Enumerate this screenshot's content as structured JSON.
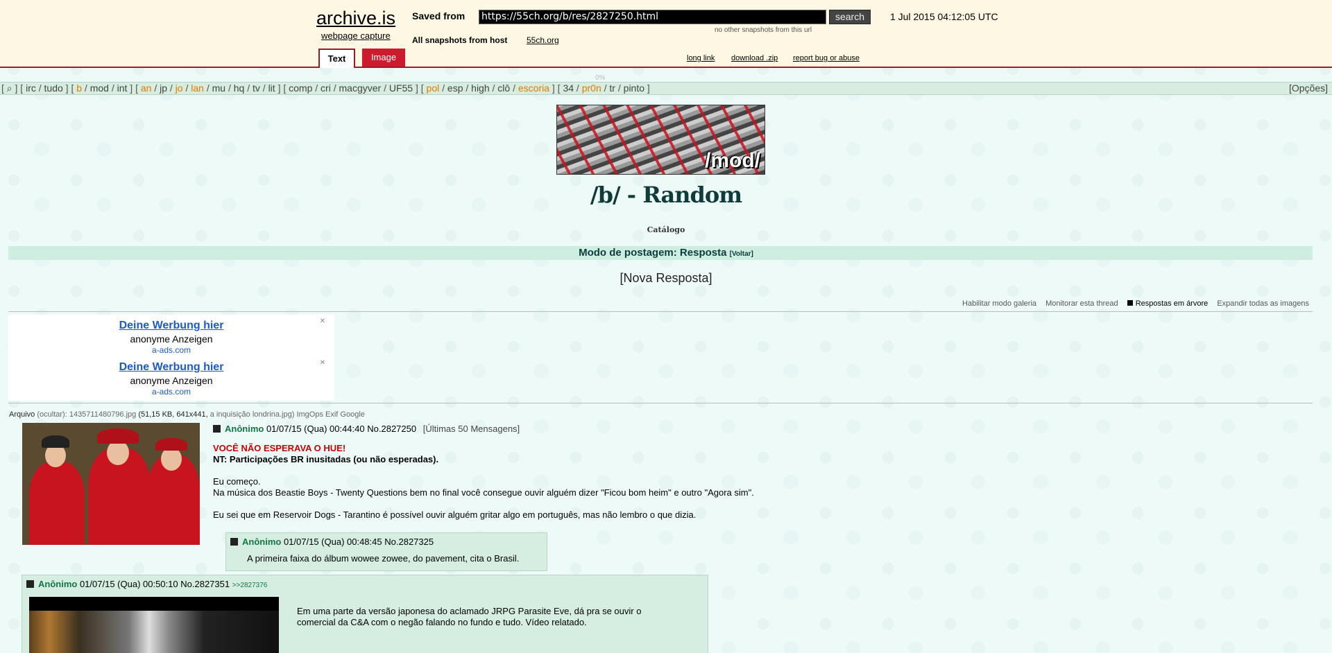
{
  "archive": {
    "logo": "archive.is",
    "subtitle": "webpage capture",
    "saved_from_label": "Saved from",
    "url": "https://55ch.org/b/res/2827250.html",
    "search_label": "search",
    "no_other_snapshots": "no other snapshots from this url",
    "all_snapshots_label": "All snapshots",
    "from_host_label": "from host",
    "host": "55ch.org",
    "date": "1 Jul 2015 04:12:05 UTC",
    "tabs": [
      "Text",
      "Image"
    ],
    "links": [
      "long link",
      "download .zip",
      "report bug or abuse"
    ],
    "progress": "0%"
  },
  "nav": {
    "groups": [
      [
        {
          "t": "⌕",
          "hl": false
        }
      ],
      [
        {
          "t": "irc",
          "hl": false
        },
        {
          "t": "tudo",
          "hl": false
        }
      ],
      [
        {
          "t": "b",
          "hl": true
        },
        {
          "t": "mod",
          "hl": false
        },
        {
          "t": "int",
          "hl": false
        }
      ],
      [
        {
          "t": "an",
          "hl": true
        },
        {
          "t": "jp",
          "hl": false
        },
        {
          "t": "jo",
          "hl": true
        },
        {
          "t": "lan",
          "hl": true
        },
        {
          "t": "mu",
          "hl": false
        },
        {
          "t": "hq",
          "hl": false
        },
        {
          "t": "tv",
          "hl": false
        },
        {
          "t": "lit",
          "hl": false
        }
      ],
      [
        {
          "t": "comp",
          "hl": false
        },
        {
          "t": "cri",
          "hl": false
        },
        {
          "t": "macgyver",
          "hl": false
        },
        {
          "t": "UF55",
          "hl": false
        }
      ],
      [
        {
          "t": "pol",
          "hl": true
        },
        {
          "t": "esp",
          "hl": false
        },
        {
          "t": "high",
          "hl": false
        },
        {
          "t": "clô",
          "hl": false
        },
        {
          "t": "escoria",
          "hl": true
        }
      ],
      [
        {
          "t": "34",
          "hl": false
        },
        {
          "t": "pr0n",
          "hl": true
        },
        {
          "t": "tr",
          "hl": false
        },
        {
          "t": "pinto",
          "hl": false
        }
      ]
    ],
    "options": "[Opções]"
  },
  "board": {
    "banner_text": "/mod/",
    "title": "/b/ - Random",
    "catalog": "Catálogo",
    "post_mode": "Modo de postagem: Resposta",
    "back": "[Voltar]",
    "new_reply": "[Nova Resposta]",
    "thread_options": {
      "gallery": "Habilitar modo galeria",
      "watch": "Monitorar esta thread",
      "tree": "Respostas em árvore",
      "expand": "Expandir todas as imagens"
    }
  },
  "ads": [
    {
      "title": "Deine Werbung hier",
      "text": "anonyme Anzeigen",
      "host": "a-ads.com"
    },
    {
      "title": "Deine Werbung hier",
      "text": "anonyme Anzeigen",
      "host": "a-ads.com"
    }
  ],
  "op": {
    "file_label": "Arquivo",
    "file_hide": "(ocultar):",
    "file_name": "1435711480796.jpg",
    "file_meta": "(51,15 KB, 641x441,",
    "file_orig": "a inquisição londrina.jpg)",
    "file_tools": "ImgOps Exif Google",
    "name": "Anônimo",
    "date": "01/07/15 (Qua) 00:44:40",
    "no": "No.2827250",
    "last50": "[Últimas 50 Mensagens]",
    "line1": "VOCÊ NÃO ESPERAVA O HUE!",
    "line2": "NT: Participações BR inusitadas (ou não esperadas).",
    "line3": "Eu começo.",
    "line4": "Na música dos Beastie Boys - Twenty Questions bem no final você consegue ouvir alguém dizer \"Ficou bom heim\" e outro \"Agora sim\".",
    "line5": "Eu sei que em Reservoir Dogs - Tarantino é possível ouvir alguém gritar algo em português, mas não lembro o que dizia."
  },
  "replies": [
    {
      "name": "Anônimo",
      "date": "01/07/15 (Qua) 00:48:45",
      "no": "No.2827325",
      "backlink": "",
      "message": "A primeira faixa do álbum wowee zowee, do pavement, cita o Brasil."
    },
    {
      "name": "Anônimo",
      "date": "01/07/15 (Qua) 00:50:10",
      "no": "No.2827351",
      "backlink": ">>2827376",
      "message1": "Em uma parte da versão japonesa do aclamado JRPG Parasite Eve, dá pra se ouvir o",
      "message2": "comercial da C&A com o negão falando no fundo e tudo. Vídeo relatado."
    }
  ]
}
